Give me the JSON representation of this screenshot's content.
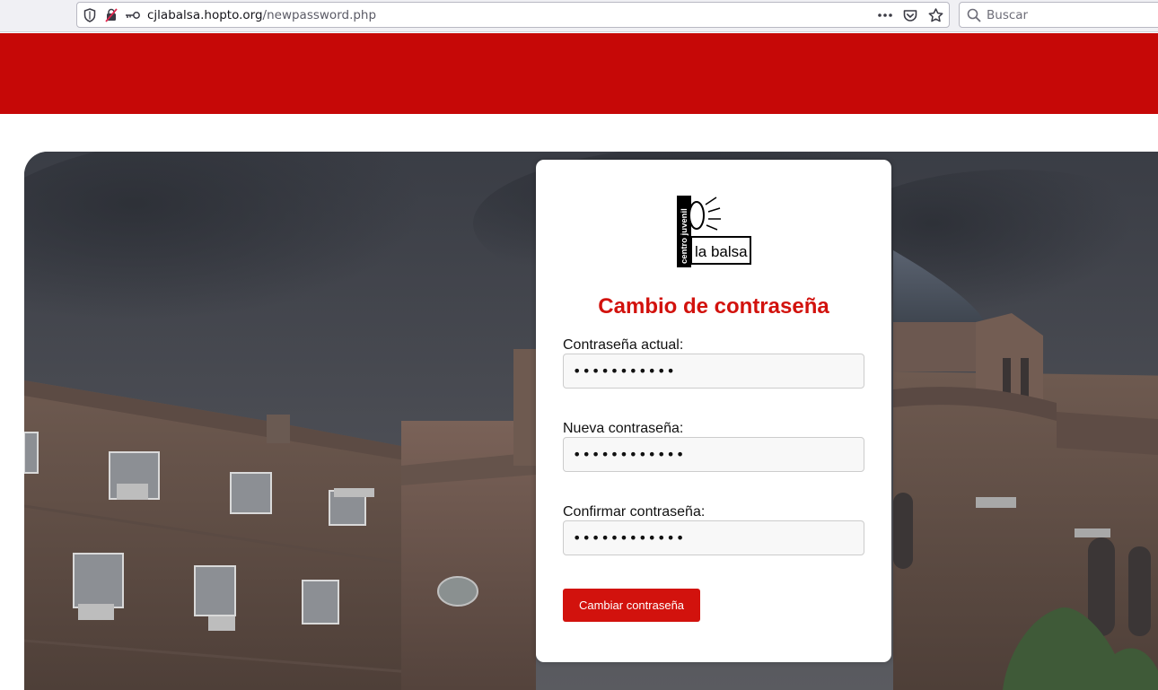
{
  "browser": {
    "url_host": "cjlabalsa.hopto.org",
    "url_path": "/newpassword.php",
    "search_placeholder": "Buscar",
    "icons": [
      "shield-icon",
      "tracking-off-icon",
      "key-icon",
      "more-dots-icon",
      "pocket-icon",
      "bookmark-star-icon",
      "search-icon"
    ]
  },
  "header": {
    "color": "#c60807"
  },
  "logo": {
    "vertical_text": "centro juvenil",
    "main_text": "la balsa"
  },
  "form": {
    "title": "Cambio de contraseña",
    "title_color": "#d2120d",
    "fields": [
      {
        "label": "Contraseña actual:",
        "value": "•••••••••••"
      },
      {
        "label": "Nueva contraseña:",
        "value": "••••••••••••"
      },
      {
        "label": "Confirmar contraseña:",
        "value": "••••••••••••"
      }
    ],
    "submit_label": "Cambiar contraseña"
  }
}
